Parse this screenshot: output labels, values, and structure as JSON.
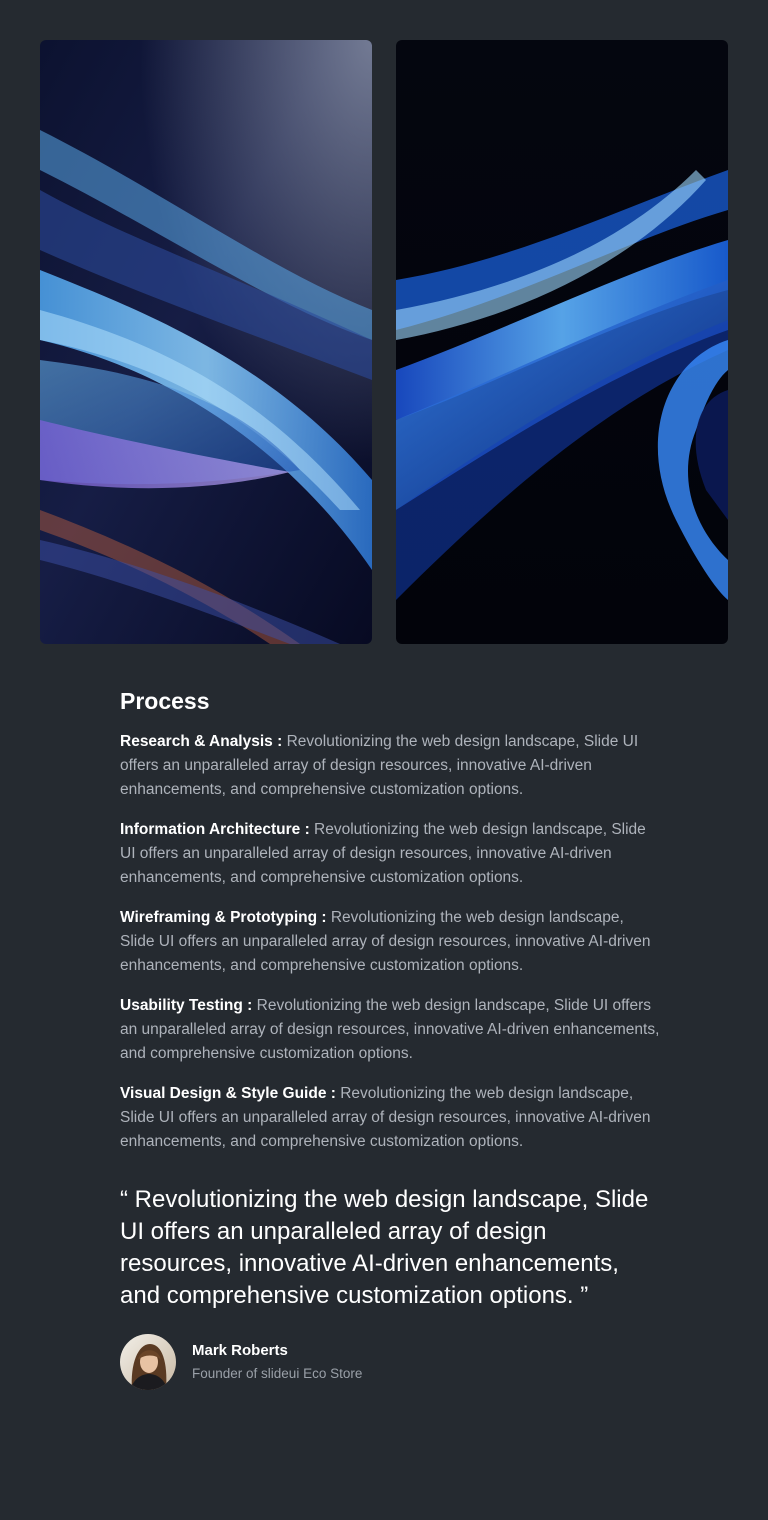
{
  "process": {
    "title": "Process",
    "items": [
      {
        "term": "Research & Analysis :",
        "text": " Revolutionizing the web design landscape, Slide UI offers an unparalleled array of design resources, innovative AI-driven enhancements, and comprehensive customization options."
      },
      {
        "term": "Information Architecture :",
        "text": " Revolutionizing the web design landscape, Slide UI offers an unparalleled array of design resources, innovative AI-driven enhancements, and comprehensive customization options."
      },
      {
        "term": "Wireframing & Prototyping :",
        "text": " Revolutionizing the web design landscape, Slide UI offers an unparalleled array of design resources, innovative AI-driven enhancements, and comprehensive customization options."
      },
      {
        "term": "Usability Testing :",
        "text": " Revolutionizing the web design landscape, Slide UI offers an unparalleled array of design resources, innovative AI-driven enhancements, and comprehensive customization options."
      },
      {
        "term": "Visual Design & Style Guide :",
        "text": " Revolutionizing the web design landscape, Slide UI offers an unparalleled array of design resources, innovative AI-driven enhancements, and comprehensive customization options."
      }
    ]
  },
  "testimonial": {
    "quote": "“ Revolutionizing the web design landscape, Slide UI offers an unparalleled array of design resources, innovative AI-driven enhancements, and comprehensive customization options. ”",
    "author_name": "Mark Roberts",
    "author_role": "Founder of slideui Eco Store"
  },
  "colors": {
    "background": "#252a30",
    "heading": "#ffffff",
    "body_text": "#aeb3bb",
    "accent_blue": "#3a8dff"
  }
}
